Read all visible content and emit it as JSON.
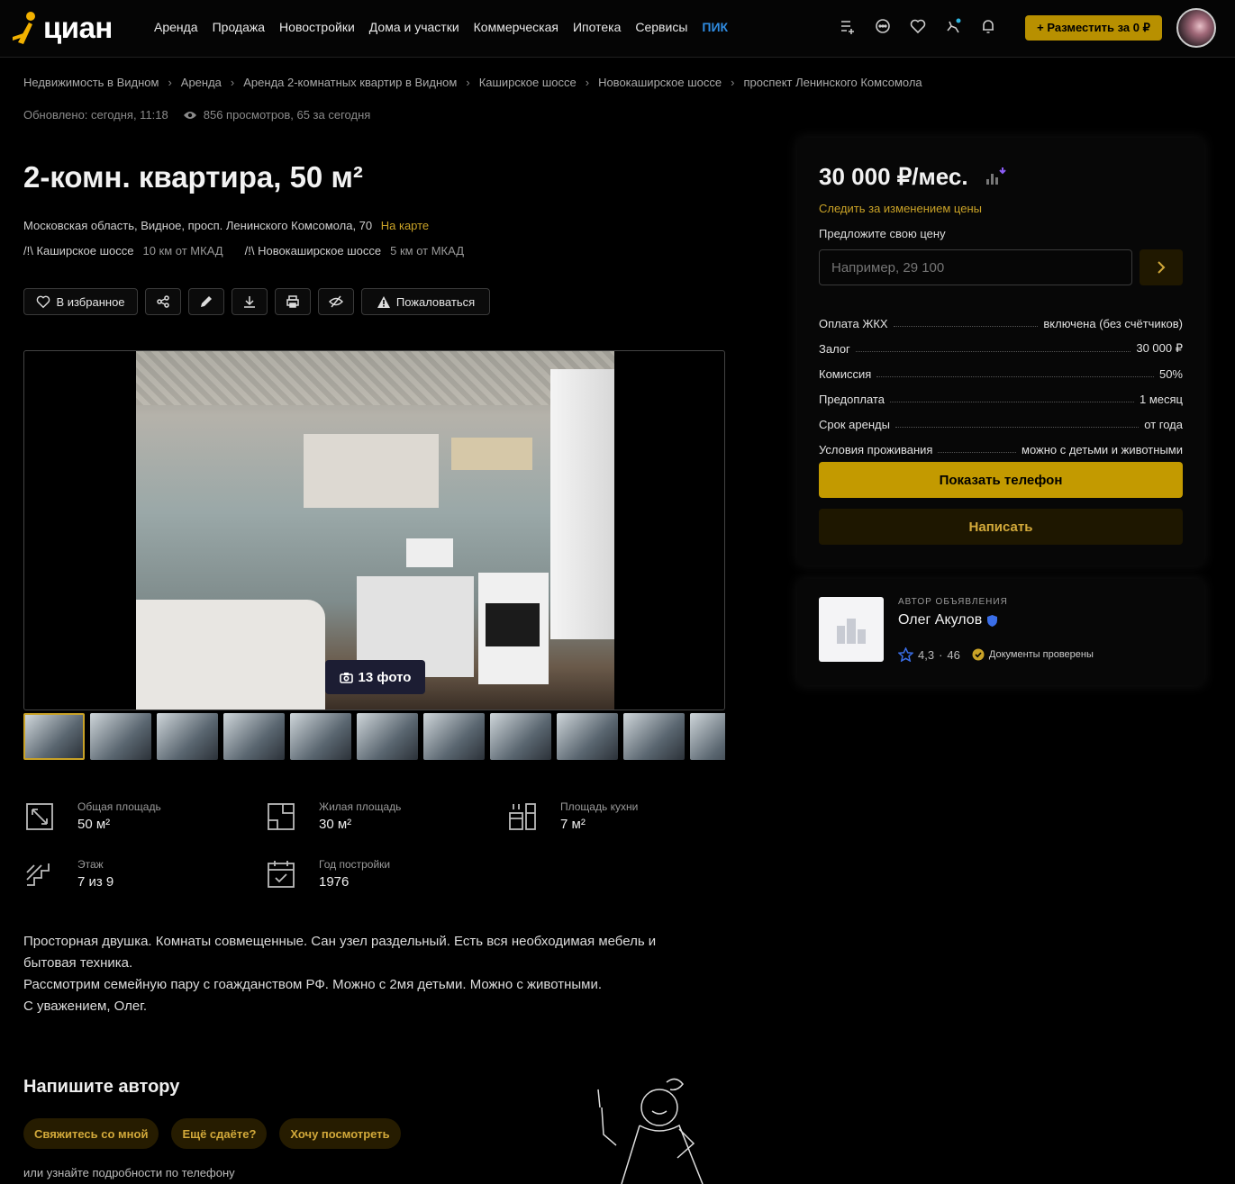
{
  "header": {
    "logo_text": "циан",
    "nav": [
      "Аренда",
      "Продажа",
      "Новостройки",
      "Дома и участки",
      "Коммерческая",
      "Ипотека",
      "Сервисы",
      "ПИК"
    ],
    "icons": [
      "compare-list-icon",
      "chat-icon",
      "heart-icon",
      "saved-search-icon",
      "bell-icon"
    ],
    "post_button": "+ Разместить за 0 ₽"
  },
  "breadcrumbs": [
    "Недвижимость в Видном",
    "Аренда",
    "Аренда 2-комнатных квартир в Видном",
    "Каширское шоссе",
    "Новокаширское шоссе",
    "проспект Ленинского Комсомола"
  ],
  "updated": "Обновлено: сегодня, 11:18",
  "views": "856 просмотров, 65 за сегодня",
  "title": "2-комн. квартира, 50 м²",
  "address": "Московская область, Видное, просп. Ленинского Комсомола, 70",
  "map_link": "На карте",
  "highways": [
    {
      "name": "Каширское шоссе",
      "distance": "10 км от МКАД"
    },
    {
      "name": "Новокаширское шоссе",
      "distance": "5 км от МКАД"
    }
  ],
  "actions": {
    "favorite": "В избранное",
    "report": "Пожаловаться"
  },
  "gallery": {
    "photo_count": "13 фото",
    "thumb_count": 11
  },
  "features": [
    {
      "label": "Общая площадь",
      "value": "50 м²",
      "icon": "area-icon"
    },
    {
      "label": "Жилая площадь",
      "value": "30 м²",
      "icon": "living-area-icon"
    },
    {
      "label": "Площадь кухни",
      "value": "7 м²",
      "icon": "kitchen-icon"
    },
    {
      "label": "Этаж",
      "value": "7 из 9",
      "icon": "stairs-icon"
    },
    {
      "label": "Год постройки",
      "value": "1976",
      "icon": "calendar-icon"
    }
  ],
  "description": [
    "Просторная двушка. Комнаты совмещенные. Сан узел раздельный. Есть вся необходимая мебель и бытовая техника.",
    "Рассмотрим семейную пару с гоажданством РФ. Можно с 2мя детьми. Можно с животными.",
    "С уважением, Олег."
  ],
  "write": {
    "title": "Напишите автору",
    "chips": [
      "Свяжитесь со мной",
      "Ещё сдаёте?",
      "Хочу посмотреть"
    ],
    "phone_note": "или узнайте подробности по телефону"
  },
  "price_card": {
    "price": "30 000 ₽/мес.",
    "follow": "Следить за изменением цены",
    "offer_label": "Предложите свою цену",
    "offer_placeholder": "Например, 29 100",
    "terms": [
      {
        "label": "Оплата ЖКХ",
        "value": "включена (без счётчиков)"
      },
      {
        "label": "Залог",
        "value": "30 000 ₽"
      },
      {
        "label": "Комиссия",
        "value": "50%"
      },
      {
        "label": "Предоплата",
        "value": "1 месяц"
      },
      {
        "label": "Срок аренды",
        "value": "от года"
      },
      {
        "label": "Условия проживания",
        "value": "можно с детьми и животными"
      }
    ],
    "phone_button": "Показать телефон",
    "message_button": "Написать"
  },
  "author": {
    "caption": "АВТОР ОБЪЯВЛЕНИЯ",
    "name": "Олег Акулов",
    "rating": "4,3",
    "reviews": "46",
    "docs": "Документы проверены"
  },
  "colors": {
    "accent": "#c39a00",
    "link": "#c9a227",
    "pik": "#2f8be0",
    "photo_badge": "#1c1d33"
  }
}
